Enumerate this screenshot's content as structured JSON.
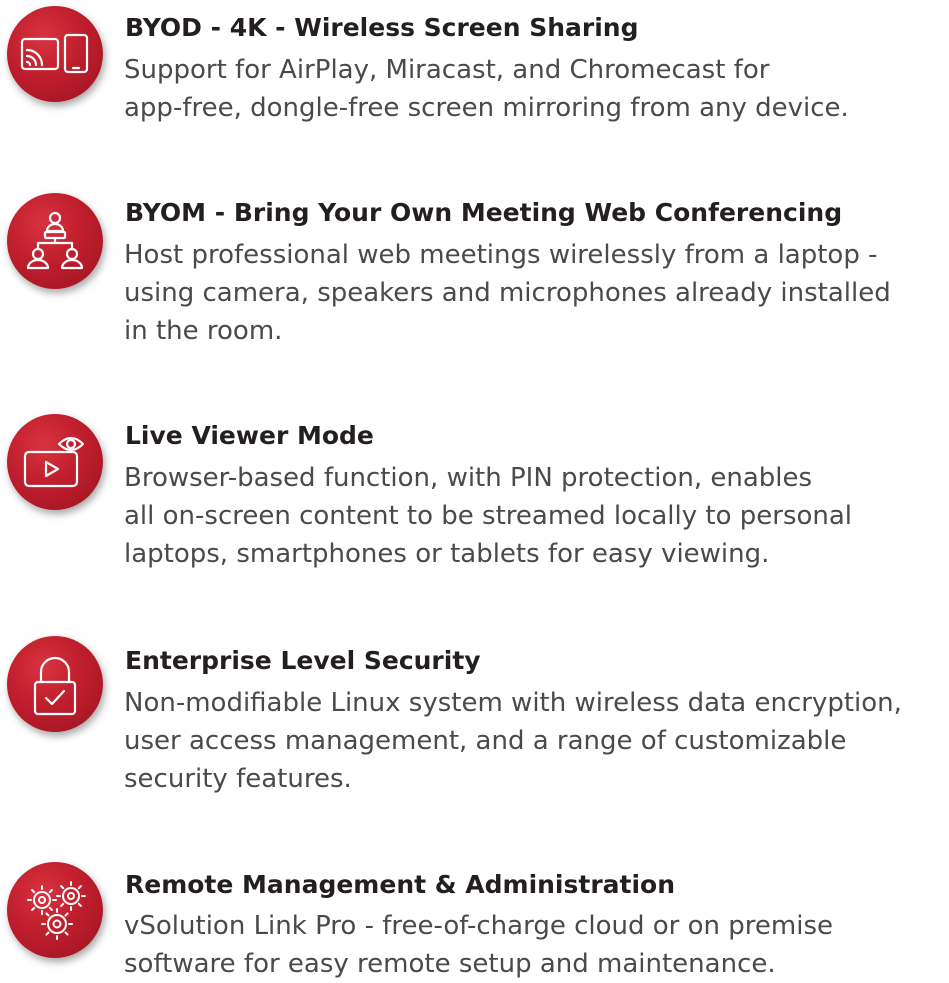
{
  "accent_color": "#bf1e2d",
  "features": [
    {
      "icon": "screen-sharing-icon",
      "title": "BYOD - 4K - Wireless Screen Sharing",
      "lines": [
        "Support for AirPlay, Miracast, and Chromecast for",
        "app-free, dongle-free screen mirroring from any device."
      ]
    },
    {
      "icon": "meeting-hierarchy-icon",
      "title": "BYOM - Bring Your Own Meeting Web Conferencing",
      "lines": [
        "Host professional web meetings wirelessly from a laptop -",
        "using camera, speakers and microphones already installed",
        "in the room."
      ]
    },
    {
      "icon": "live-viewer-icon",
      "title": "Live Viewer Mode",
      "lines": [
        "Browser-based function, with PIN protection, enables",
        "all on-screen content to be streamed locally to personal",
        "laptops, smartphones or tablets for easy viewing."
      ]
    },
    {
      "icon": "padlock-check-icon",
      "title": "Enterprise Level Security",
      "lines": [
        "Non-modifiable Linux system with wireless data encryption,",
        "user access management, and a range of customizable",
        "security features."
      ]
    },
    {
      "icon": "gears-icon",
      "title": "Remote Management & Administration",
      "lines": [
        "vSolution Link Pro - free-of-charge cloud or on premise",
        "software for easy remote setup and maintenance."
      ]
    }
  ]
}
